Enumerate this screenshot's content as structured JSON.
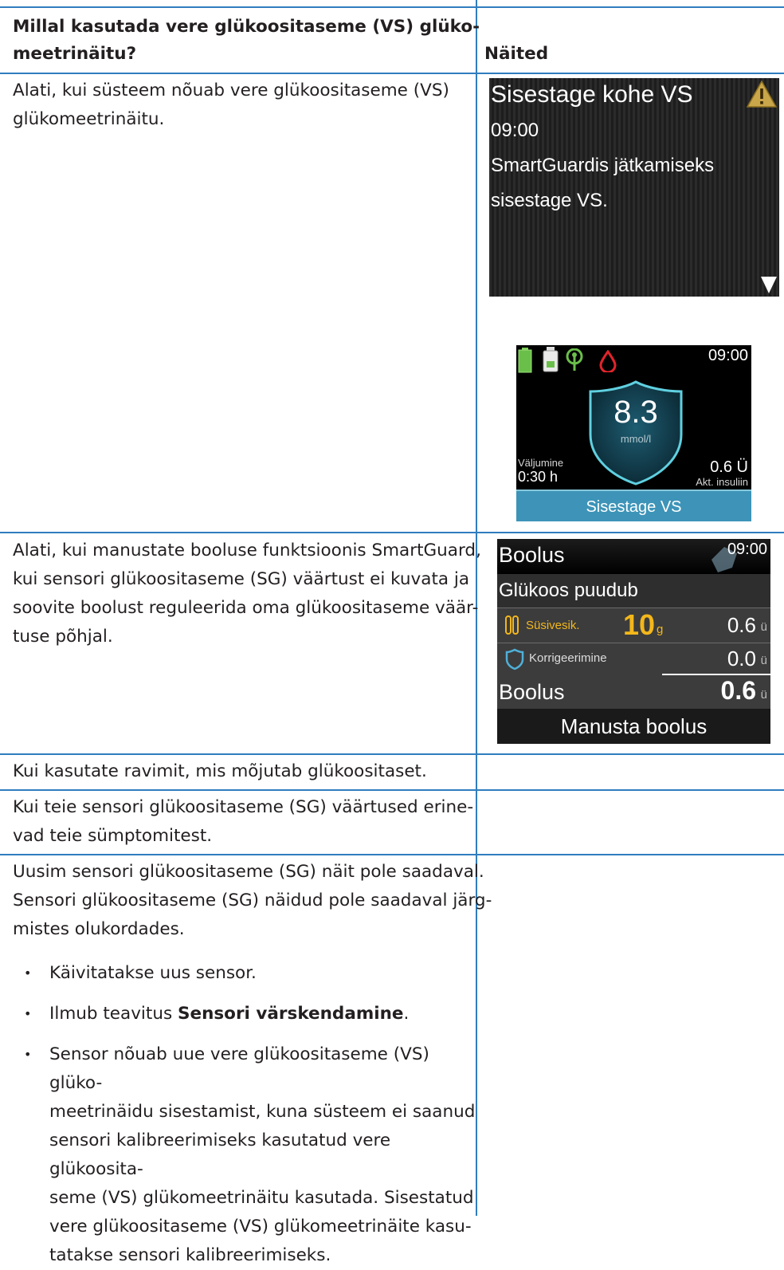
{
  "header": {
    "col1_line1": "Millal kasutada vere glükoositaseme (VS) glüko-",
    "col1_line2": "meetrinäitu?",
    "col2": "Näited"
  },
  "rows": [
    {
      "lines": [
        "Alati, kui süsteem nõuab vere glükoositaseme (VS)",
        "glükomeetrinäitu."
      ]
    },
    {
      "lines": [
        "Alati, kui manustate booluse funktsioonis SmartGuard,",
        "kui sensori glükoositaseme (SG) väärtust ei kuvata ja",
        "soovite boolust reguleerida oma glükoositaseme väär-",
        "tuse põhjal."
      ]
    },
    {
      "lines": [
        "Kui kasutate ravimit, mis mõjutab glükoositaset."
      ]
    },
    {
      "lines": [
        "Kui teie sensori glükoositaseme (SG) väärtused erine-",
        "vad teie sümptomitest."
      ]
    },
    {
      "lines": [
        "Uusim sensori glükoositaseme (SG) näit pole saadaval.",
        "Sensori glükoositaseme (SG) näidud pole saadaval järg-",
        "mistes olukordades."
      ],
      "bullets": {
        "b1": "Käivitatakse uus sensor.",
        "b2_pre": "Ilmub teavitus ",
        "b2_bold": "Sensori värskendamine",
        "b2_post": ".",
        "b3": [
          "Sensor nõuab uue vere glükoositaseme (VS) glüko-",
          "meetrinäidu sisestamist, kuna süsteem ei saanud",
          "sensori kalibreerimiseks kasutatud vere glükoosita-",
          "seme (VS) glükomeetrinäitu kasutada. Sisestatud",
          "vere glükoositaseme (VS) glükomeetrinäite kasu-",
          "tatakse sensori kalibreerimiseks."
        ]
      }
    }
  ],
  "screen1": {
    "title": "Sisestage kohe VS",
    "time": "09:00",
    "msg1": "SmartGuardis jätkamiseks",
    "msg2": "sisestage VS.",
    "warn_icon": "warning-triangle-icon",
    "down_icon": "down-arrow-icon"
  },
  "screen2": {
    "time": "09:00",
    "value": "8.3",
    "unit": "mmol/l",
    "exit_label": "Väljumine",
    "exit_value": "0:30 h",
    "insulin_value": "0.6 Ü",
    "insulin_label": "Akt. insuliin",
    "button": "Sisestage VS",
    "icons": [
      "battery-icon",
      "reservoir-icon",
      "sensor-icon",
      "blood-drop-icon",
      "shield-icon"
    ]
  },
  "screen3": {
    "title": "Boolus",
    "time": "09:00",
    "glucose": "Glükoos puudub",
    "carb_label": "Süsivesik.",
    "carb_value": "10",
    "carb_unit": "g",
    "carb_insulin": "0.6",
    "correction_label": "Korrigeerimine",
    "correction_value": "0.0",
    "bolus_label": "Boolus",
    "bolus_value": "0.6",
    "unit": "ü",
    "button": "Manusta boolus",
    "icons": [
      "carb-icon",
      "shield-icon"
    ],
    "colors": {
      "accent": "#f3b71b"
    }
  }
}
